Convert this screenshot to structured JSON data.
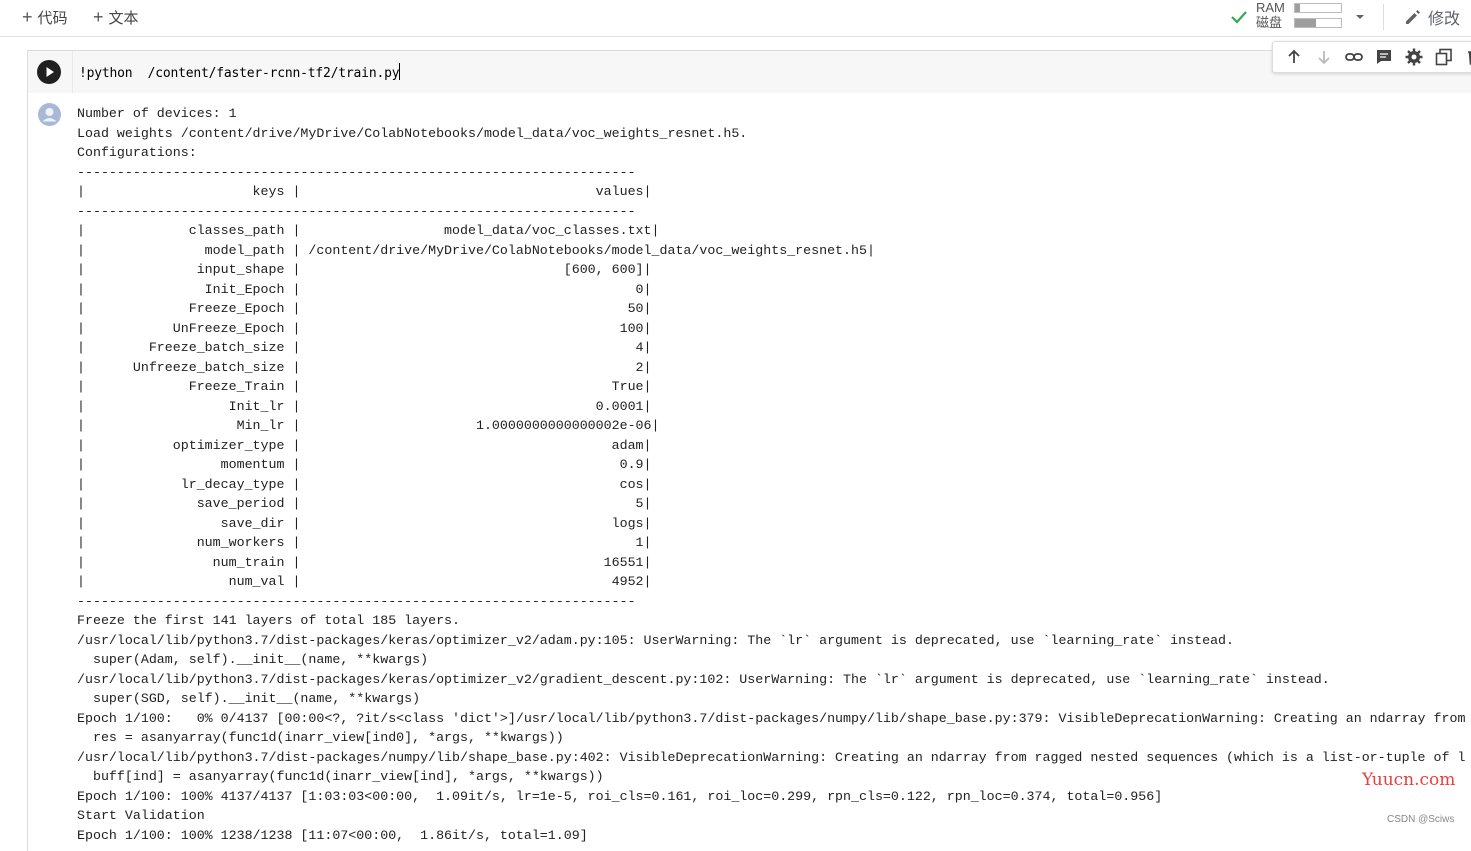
{
  "toolbar": {
    "add_code_label": "代码",
    "add_text_label": "文本",
    "ram_label": "RAM",
    "disk_label": "磁盘",
    "ram_usage": 0.1,
    "disk_usage": 0.45,
    "edit_label": "修改",
    "status_color": "#34a853"
  },
  "cell": {
    "code": "!python  /content/faster-rcnn-tf2/train.py",
    "toolbar_icons": [
      "arrow-up-icon",
      "arrow-down-icon",
      "link-icon",
      "comment-icon",
      "gear-icon",
      "mirror-cell-icon",
      "delete-icon"
    ],
    "output_lines": [
      "Number of devices: 1",
      "Load weights /content/drive/MyDrive/ColabNotebooks/model_data/voc_weights_resnet.h5.",
      "Configurations:",
      "----------------------------------------------------------------------",
      "|                     keys |                                     values|",
      "----------------------------------------------------------------------",
      "|             classes_path |                  model_data/voc_classes.txt|",
      "|               model_path | /content/drive/MyDrive/ColabNotebooks/model_data/voc_weights_resnet.h5|",
      "|              input_shape |                                 [600, 600]|",
      "|               Init_Epoch |                                          0|",
      "|             Freeze_Epoch |                                         50|",
      "|           UnFreeze_Epoch |                                        100|",
      "|        Freeze_batch_size |                                          4|",
      "|      Unfreeze_batch_size |                                          2|",
      "|             Freeze_Train |                                       True|",
      "|                  Init_lr |                                     0.0001|",
      "|                   Min_lr |                      1.0000000000000002e-06|",
      "|           optimizer_type |                                       adam|",
      "|                 momentum |                                        0.9|",
      "|            lr_decay_type |                                        cos|",
      "|              save_period |                                          5|",
      "|                 save_dir |                                       logs|",
      "|              num_workers |                                          1|",
      "|                num_train |                                      16551|",
      "|                  num_val |                                       4952|",
      "----------------------------------------------------------------------",
      "Freeze the first 141 layers of total 185 layers.",
      "/usr/local/lib/python3.7/dist-packages/keras/optimizer_v2/adam.py:105: UserWarning: The `lr` argument is deprecated, use `learning_rate` instead.",
      "  super(Adam, self).__init__(name, **kwargs)",
      "/usr/local/lib/python3.7/dist-packages/keras/optimizer_v2/gradient_descent.py:102: UserWarning: The `lr` argument is deprecated, use `learning_rate` instead.",
      "  super(SGD, self).__init__(name, **kwargs)",
      "Epoch 1/100:   0% 0/4137 [00:00<?, ?it/s<class 'dict'>]/usr/local/lib/python3.7/dist-packages/numpy/lib/shape_base.py:379: VisibleDeprecationWarning: Creating an ndarray from",
      "  res = asanyarray(func1d(inarr_view[ind0], *args, **kwargs))",
      "/usr/local/lib/python3.7/dist-packages/numpy/lib/shape_base.py:402: VisibleDeprecationWarning: Creating an ndarray from ragged nested sequences (which is a list-or-tuple of l",
      "  buff[ind] = asanyarray(func1d(inarr_view[ind], *args, **kwargs))",
      "Epoch 1/100: 100% 4137/4137 [1:03:03<00:00,  1.09it/s, lr=1e-5, roi_cls=0.161, roi_loc=0.299, rpn_cls=0.122, rpn_loc=0.374, total=0.956]",
      "Start Validation",
      "Epoch 1/100: 100% 1238/1238 [11:07<00:00,  1.86it/s, total=1.09]"
    ]
  },
  "watermark": {
    "site": "Yuucn.com",
    "credit": "CSDN @Sciws"
  }
}
